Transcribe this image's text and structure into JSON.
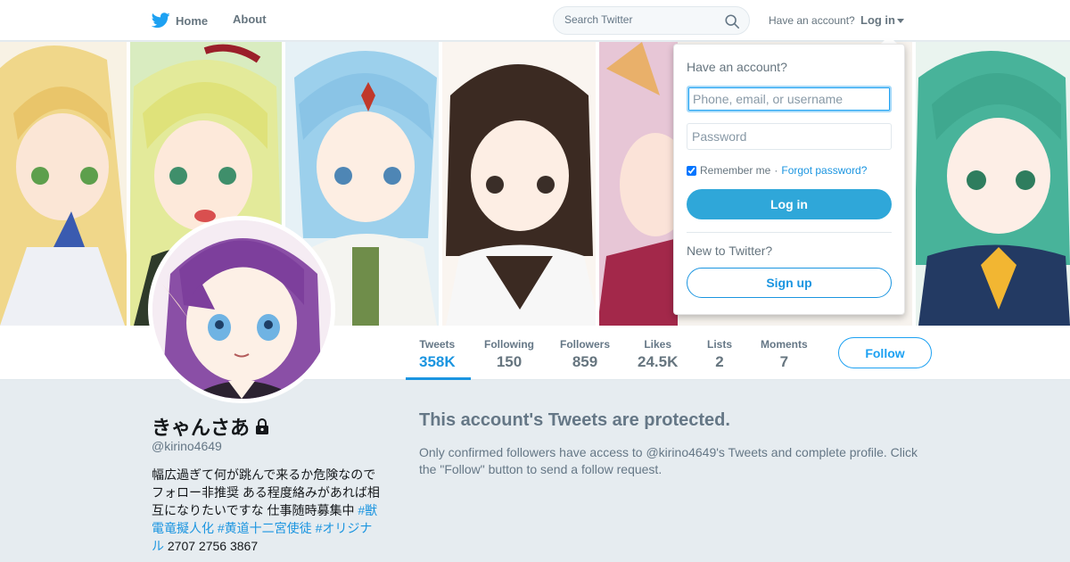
{
  "nav": {
    "home_label": "Home",
    "about_label": "About",
    "search_placeholder": "Search Twitter",
    "have_account_text": "Have an account?",
    "login_label": "Log in"
  },
  "profile": {
    "name": "きゃんさあ",
    "handle": "@kirino4649",
    "bio_text": "幅広過ぎて何が跳んで来るか危険なのでフォロー非推奨 ある程度絡みがあれば相互になりたいですな 仕事随時募集中 ",
    "bio_links": [
      "#獣電竜擬人化",
      "#黄道十二宮使徒",
      "#オリジナル"
    ],
    "bio_suffix": " 2707 2756 3867",
    "follow_label": "Follow"
  },
  "stats": [
    {
      "label": "Tweets",
      "value": "358K"
    },
    {
      "label": "Following",
      "value": "150"
    },
    {
      "label": "Followers",
      "value": "859"
    },
    {
      "label": "Likes",
      "value": "24.5K"
    },
    {
      "label": "Lists",
      "value": "2"
    },
    {
      "label": "Moments",
      "value": "7"
    }
  ],
  "protected": {
    "title": "This account's Tweets are protected.",
    "text": "Only confirmed followers have access to @kirino4649's Tweets and complete profile. Click the \"Follow\" button to send a follow request."
  },
  "login_dropdown": {
    "title": "Have an account?",
    "username_placeholder": "Phone, email, or username",
    "password_placeholder": "Password",
    "remember_label": "Remember me",
    "separator": "·",
    "forgot_label": "Forgot password?",
    "login_button": "Log in",
    "new_text": "New to Twitter?",
    "signup_button": "Sign up"
  },
  "colors": {
    "accent": "#1da1f2",
    "link": "#1b95e0",
    "login_button": "#2fa7d9",
    "background": "#e6ecf0"
  },
  "icons": {
    "brand": "twitter-bird-icon",
    "search": "search-icon",
    "protected": "lock-icon",
    "menu": "caret-down-icon"
  },
  "banner": {
    "description_free": true
  }
}
